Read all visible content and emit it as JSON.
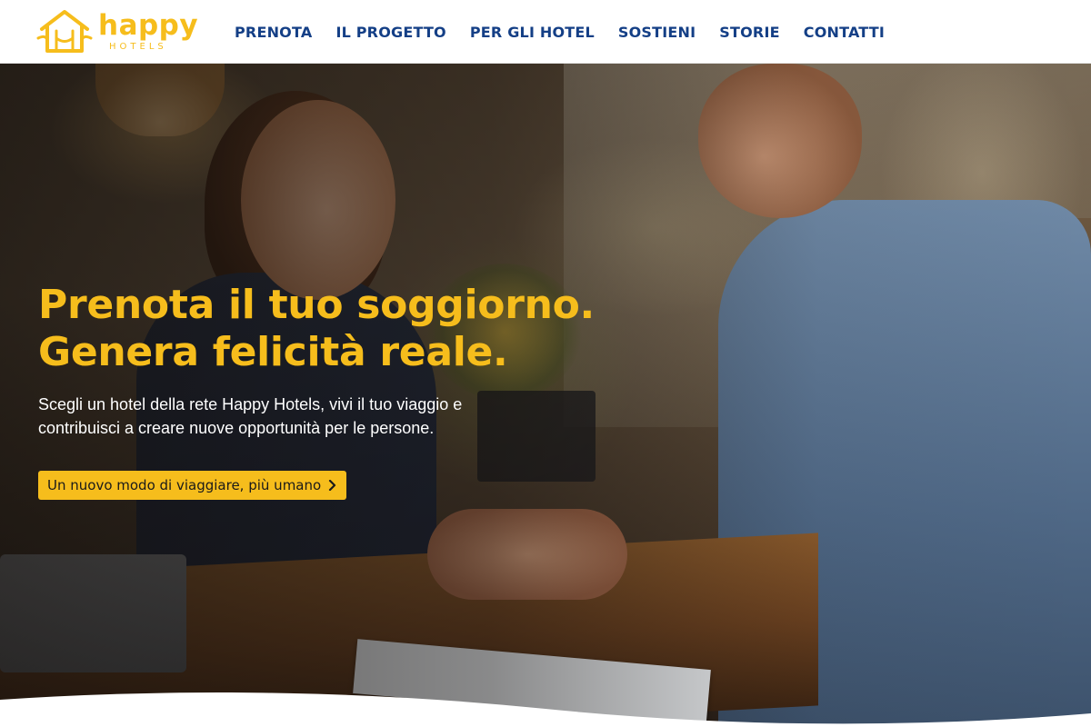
{
  "brand": {
    "name": "happy",
    "subtitle": "HOTELS",
    "color": "#f6bd1c"
  },
  "nav": {
    "items": [
      {
        "label": "PRENOTA"
      },
      {
        "label": "IL PROGETTO"
      },
      {
        "label": "PER GLI HOTEL"
      },
      {
        "label": "SOSTIENI"
      },
      {
        "label": "STORIE"
      },
      {
        "label": "CONTATTI"
      }
    ],
    "color": "#143f86"
  },
  "hero": {
    "title_line1": "Prenota il tuo soggiorno.",
    "title_line2": "Genera felicità reale.",
    "text_line1": "Scegli un hotel della rete Happy Hotels, vivi il tuo viaggio e",
    "text_line2": "contribuisci a creare nuove opportunità per le persone.",
    "cta_label": "Un nuovo modo di viaggiare, più umano",
    "cta_icon": "chevron-right-icon",
    "image": "hotel-reception-handshake-photo"
  }
}
